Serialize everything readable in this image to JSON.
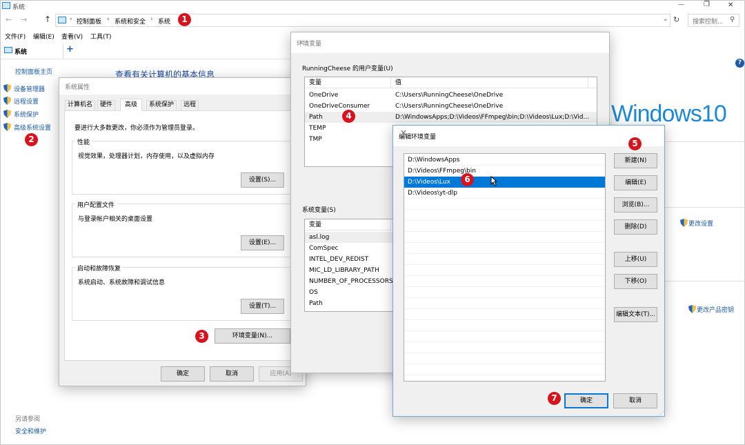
{
  "title_bar": {
    "title": "系统",
    "minimize": "—",
    "maximize": "❐",
    "close": "✕"
  },
  "address_bar": {
    "back": "←",
    "forward": "→",
    "up": "↑",
    "crumbs": [
      "控制面板",
      "系统和安全",
      "系统"
    ],
    "refresh": "↻",
    "search_placeholder": "搜索控制..."
  },
  "menu": {
    "file": "文件(F)",
    "edit": "编辑(E)",
    "view": "查看(V)",
    "tools": "工具(T)"
  },
  "tab": {
    "label": "系统",
    "add": "+"
  },
  "sidebar": {
    "home": "控制面板主页",
    "items": [
      "设备管理器",
      "远程设置",
      "系统保护",
      "高级系统设置"
    ],
    "see_also": "另请参阅",
    "security": "安全和维护"
  },
  "main": {
    "heading": "查看有关计算机的基本信息",
    "windows_logo": "Windows10",
    "change_settings": "更改设置",
    "change_key": "更改产品密钥"
  },
  "sysprops": {
    "title": "系统属性",
    "tabs": [
      "计算机名",
      "硬件",
      "高级",
      "系统保护",
      "远程"
    ],
    "notice": "要进行大多数更改，你必须作为管理员登录。",
    "perf_label": "性能",
    "perf_desc": "视觉效果，处理器计划，内存使用，以及虚拟内存",
    "profile_label": "用户配置文件",
    "profile_desc": "与登录帐户相关的桌面设置",
    "startup_label": "启动和故障恢复",
    "startup_desc": "系统启动、系统故障和调试信息",
    "settings_btn": "设置(S)...",
    "settings_e_btn": "设置(E)...",
    "settings_t_btn": "设置(T)...",
    "env_btn": "环境变量(N)...",
    "ok": "确定",
    "cancel": "取消",
    "apply": "应用(A)"
  },
  "envvars": {
    "title": "环境变量",
    "user_label": "RunningCheese 的用户变量(U)",
    "col_var": "变量",
    "col_val": "值",
    "user_rows": [
      {
        "name": "OneDrive",
        "value": "C:\\Users\\RunningCheese\\OneDrive"
      },
      {
        "name": "OneDriveConsumer",
        "value": "C:\\Users\\RunningCheese\\OneDrive"
      },
      {
        "name": "Path",
        "value": "D:\\WindowsApps;D:\\Videos\\FFmpeg\\bin;D:\\Videos\\Lux;D:\\Vid..."
      },
      {
        "name": "TEMP",
        "value": ""
      },
      {
        "name": "TMP",
        "value": ""
      }
    ],
    "sys_label": "系统变量(S)",
    "sys_rows": [
      "asl.log",
      "ComSpec",
      "INTEL_DEV_REDIST",
      "MIC_LD_LIBRARY_PATH",
      "NUMBER_OF_PROCESSORS",
      "OS",
      "Path"
    ]
  },
  "editenv": {
    "title": "编辑环境变量",
    "items": [
      "D:\\WindowsApps",
      "D:\\Videos\\FFmpeg\\bin",
      "D:\\Videos\\Lux",
      "D:\\Videos\\yt-dlp"
    ],
    "selected_index": 2,
    "buttons": {
      "new": "新建(N)",
      "edit": "编辑(E)",
      "browse": "浏览(B)...",
      "delete": "删除(D)",
      "up": "上移(U)",
      "down": "下移(O)",
      "edit_text": "编辑文本(T)..."
    },
    "ok": "确定",
    "cancel": "取消"
  },
  "markers": [
    "1",
    "2",
    "3",
    "4",
    "5",
    "6",
    "7"
  ],
  "colors": {
    "accent": "#0078d7",
    "link": "#1a5aa8",
    "marker": "#d7141e"
  }
}
